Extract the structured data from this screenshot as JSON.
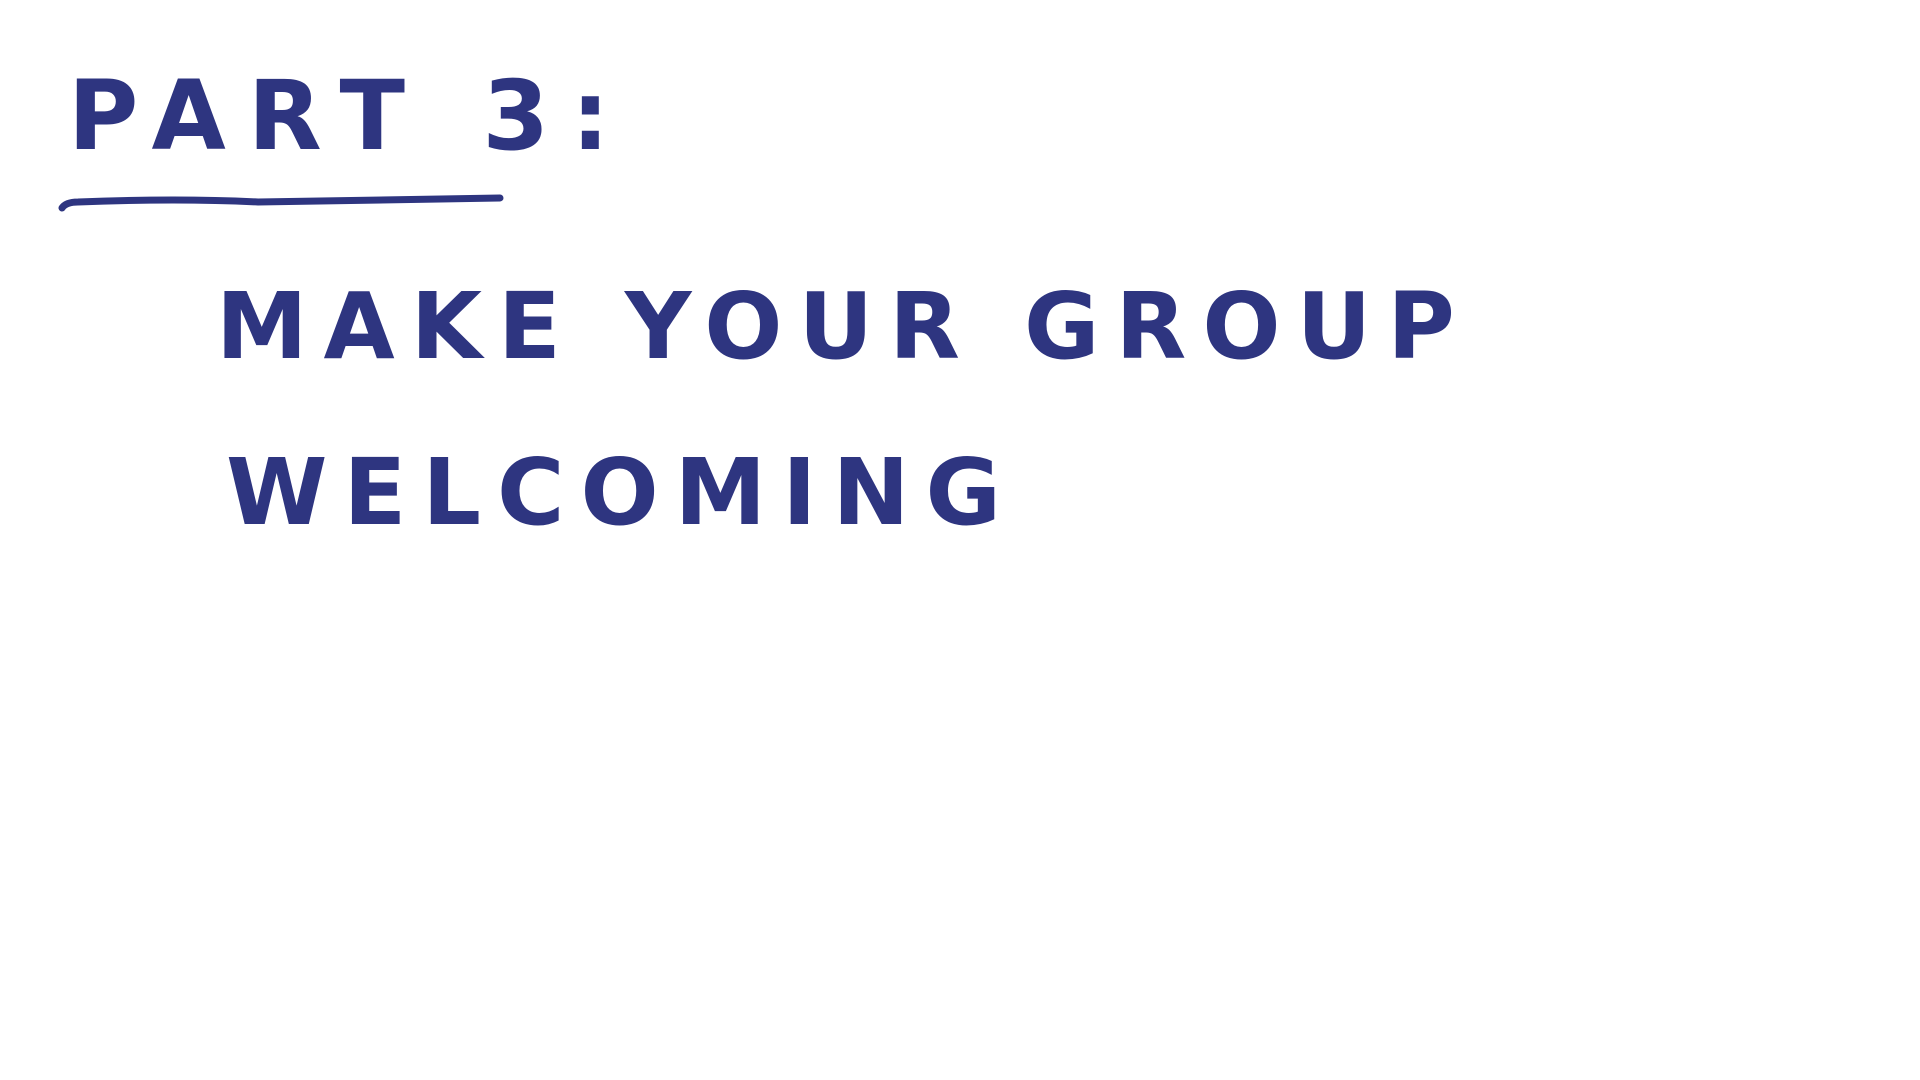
{
  "ink_color": "#2e3580",
  "heading": {
    "text": "PART 3:"
  },
  "body": {
    "line1": "MAKE YOUR GROUP",
    "line2": "WELCOMING"
  }
}
